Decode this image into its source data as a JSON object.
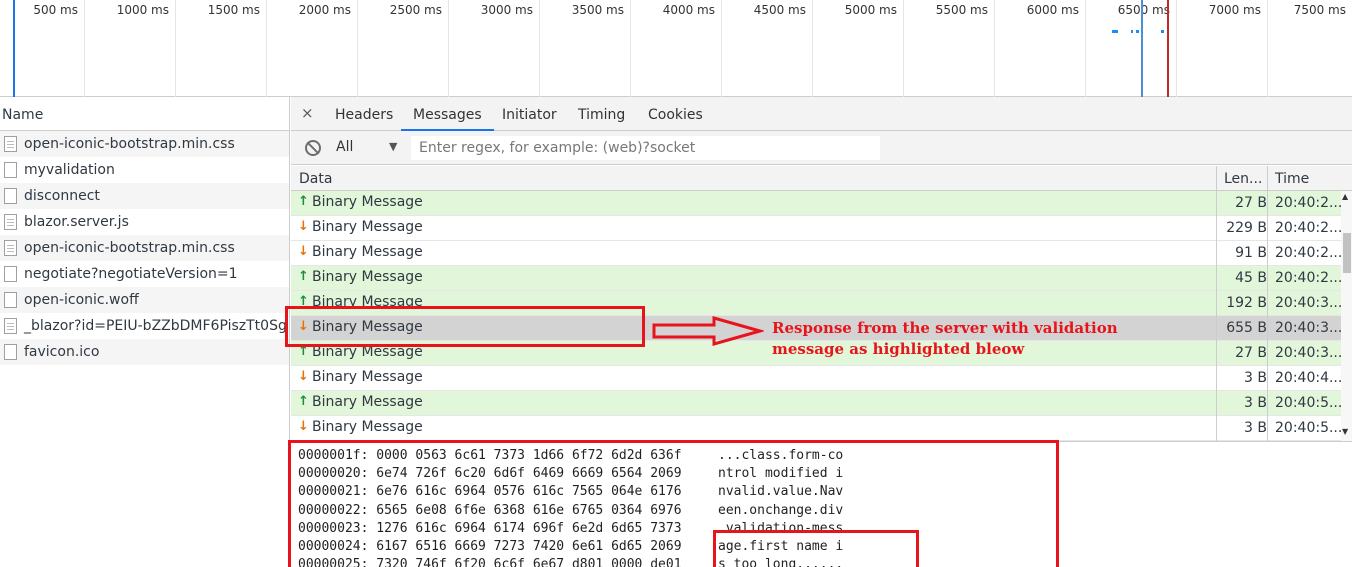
{
  "timeline": {
    "ticks": [
      "500 ms",
      "1000 ms",
      "1500 ms",
      "2000 ms",
      "2500 ms",
      "3000 ms",
      "3500 ms",
      "4000 ms",
      "4500 ms",
      "5000 ms",
      "5500 ms",
      "6000 ms",
      "6500 ms",
      "7000 ms",
      "7500 ms"
    ]
  },
  "requests": {
    "header": "Name",
    "items": [
      {
        "name": "open-iconic-bootstrap.min.css",
        "icon": "file-icon"
      },
      {
        "name": "myvalidation",
        "icon": "file-icon"
      },
      {
        "name": "disconnect",
        "icon": "file-icon"
      },
      {
        "name": "blazor.server.js",
        "icon": "file-icon"
      },
      {
        "name": "open-iconic-bootstrap.min.css",
        "icon": "file-icon"
      },
      {
        "name": "negotiate?negotiateVersion=1",
        "icon": "file-icon"
      },
      {
        "name": "open-iconic.woff",
        "icon": "file-icon"
      },
      {
        "name": "_blazor?id=PEIU-bZZbDMF6PiszTt0Sg",
        "icon": "file-icon"
      },
      {
        "name": "favicon.ico",
        "icon": "file-icon"
      }
    ]
  },
  "tabs": {
    "close": "×",
    "items": [
      "Headers",
      "Messages",
      "Initiator",
      "Timing",
      "Cookies"
    ],
    "active": "Messages"
  },
  "filter": {
    "select_value": "All",
    "caret": "▼",
    "placeholder": "Enter regex, for example: (web)?socket"
  },
  "messages": {
    "columns": [
      "Data",
      "Len...",
      "Time"
    ],
    "rows": [
      {
        "dir": "up",
        "arrow": "↑",
        "data": "Binary Message",
        "length": "27 B",
        "time": "20:40:2..."
      },
      {
        "dir": "down",
        "arrow": "↓",
        "data": "Binary Message",
        "length": "229 B",
        "time": "20:40:2..."
      },
      {
        "dir": "down",
        "arrow": "↓",
        "data": "Binary Message",
        "length": "91 B",
        "time": "20:40:2..."
      },
      {
        "dir": "up",
        "arrow": "↑",
        "data": "Binary Message",
        "length": "45 B",
        "time": "20:40:2..."
      },
      {
        "dir": "up",
        "arrow": "↑",
        "data": "Binary Message",
        "length": "192 B",
        "time": "20:40:3..."
      },
      {
        "dir": "down",
        "arrow": "↓",
        "data": "Binary Message",
        "length": "655 B",
        "time": "20:40:3...",
        "selected": true
      },
      {
        "dir": "up",
        "arrow": "↑",
        "data": "Binary Message",
        "length": "27 B",
        "time": "20:40:3..."
      },
      {
        "dir": "down",
        "arrow": "↓",
        "data": "Binary Message",
        "length": "3 B",
        "time": "20:40:4..."
      },
      {
        "dir": "up",
        "arrow": "↑",
        "data": "Binary Message",
        "length": "3 B",
        "time": "20:40:5..."
      },
      {
        "dir": "down",
        "arrow": "↓",
        "data": "Binary Message",
        "length": "3 B",
        "time": "20:40:5..."
      }
    ]
  },
  "hex": {
    "lines": [
      {
        "offset": "0000001f:",
        "bytes": "0000 0563 6c61 7373 1d66 6f72 6d2d 636f",
        "ascii": "...class.form-co"
      },
      {
        "offset": "00000020:",
        "bytes": "6e74 726f 6c20 6d6f 6469 6669 6564 2069",
        "ascii": "ntrol modified i"
      },
      {
        "offset": "00000021:",
        "bytes": "6e76 616c 6964 0576 616c 7565 064e 6176",
        "ascii": "nvalid.value.Nav"
      },
      {
        "offset": "00000022:",
        "bytes": "6565 6e08 6f6e 6368 616e 6765 0364 6976",
        "ascii": "een.onchange.div"
      },
      {
        "offset": "00000023:",
        "bytes": "1276 616c 6964 6174 696f 6e2d 6d65 7373",
        "ascii": ".validation-mess"
      },
      {
        "offset": "00000024:",
        "bytes": "6167 6516 6669 7273 7420 6e61 6d65 2069",
        "ascii": "age.first name i"
      },
      {
        "offset": "00000025:",
        "bytes": "7320 746f 6f20 6c6f 6e67 d801 0000 de01",
        "ascii": "s too long......"
      }
    ]
  },
  "annotation": {
    "line1": "Response from the server with validation",
    "line2": "message as highlighted bleow",
    "color": "#e8141b"
  },
  "colors": {
    "sent_row": "#e2f7da",
    "selected_row": "#d3d3d3",
    "active_tab": "#1a73e8",
    "up_arrow": "#1e8e3e",
    "down_arrow": "#e8710a"
  }
}
